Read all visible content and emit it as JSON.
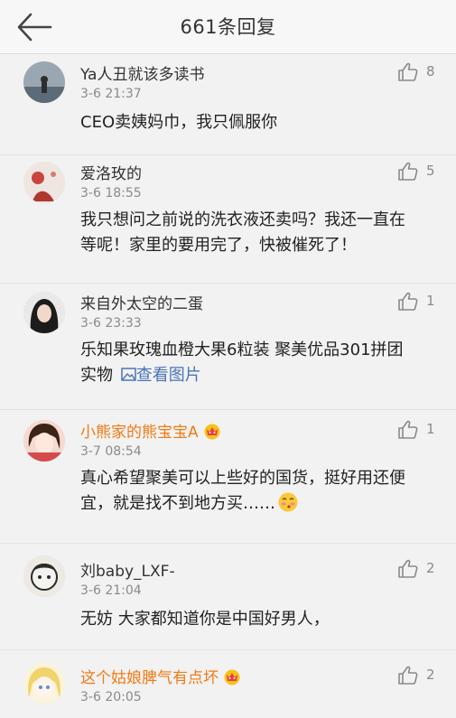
{
  "header": {
    "title": "661条回复",
    "back_icon": "arrow-left-icon"
  },
  "colors": {
    "vip_name": "#f07a14",
    "link": "#4a74b5",
    "meta": "#8a8a8a"
  },
  "comments": [
    {
      "user": "Ya人丑就该多读书",
      "time": "3-6 21:37",
      "likes": "8",
      "text": "CEO卖姨妈巾，我只佩服你"
    },
    {
      "user": "爱洛玫的",
      "time": "3-6 18:55",
      "likes": "5",
      "text_line1": "我只想问之前说的洗衣液还卖吗？我还一直在",
      "text_line2": "等呢！家里的要用完了，快被催死了！"
    },
    {
      "user": "来自外太空的二蛋",
      "time": "3-6 23:33",
      "likes": "1",
      "text_line1": "乐知果玫瑰血橙大果6粒装 聚美优品301拼团",
      "text_line2": "实物",
      "link": "查看图片",
      "link_icon": "image-icon"
    },
    {
      "user": "小熊家的熊宝宝A",
      "vip": true,
      "badge_icon": "crown-badge-icon",
      "time": "3-7 08:54",
      "likes": "1",
      "text_line1": "真心希望聚美可以上些好的国货，挺好用还便",
      "text_line2": "宜，就是找不到地方买……",
      "emoji_icon": "blushing-emoji-icon"
    },
    {
      "user": "刘baby_LXF-",
      "time": "3-6 21:04",
      "likes": "2",
      "text": "无妨 大家都知道你是中国好男人，"
    },
    {
      "user": "这个姑娘脾气有点坏",
      "vip": true,
      "badge_icon": "crown-badge-icon",
      "time": "3-6 20:05",
      "likes": "2"
    }
  ]
}
